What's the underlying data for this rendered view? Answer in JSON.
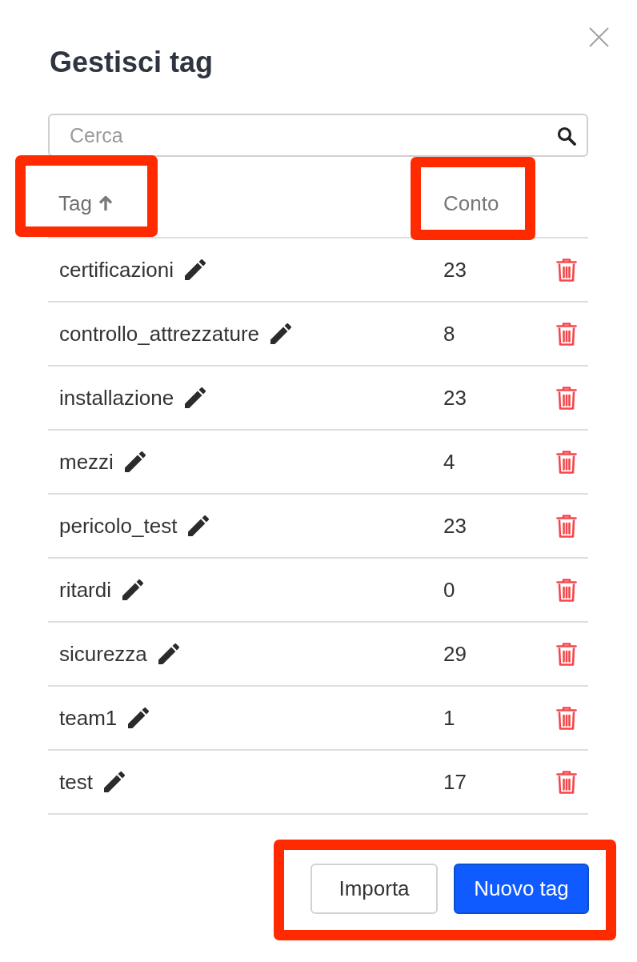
{
  "dialog": {
    "title": "Gestisci tag"
  },
  "search": {
    "placeholder": "Cerca"
  },
  "table": {
    "columns": [
      {
        "label": "Tag",
        "sorted": true,
        "highlighted": true
      },
      {
        "label": "Conto",
        "sorted": false,
        "highlighted": true
      }
    ],
    "rows": [
      {
        "tag": "certificazioni",
        "count": "23"
      },
      {
        "tag": "controllo_attrezzature",
        "count": "8"
      },
      {
        "tag": "installazione",
        "count": "23"
      },
      {
        "tag": "mezzi",
        "count": "4"
      },
      {
        "tag": "pericolo_test",
        "count": "23"
      },
      {
        "tag": "ritardi",
        "count": "0"
      },
      {
        "tag": "sicurezza",
        "count": "29"
      },
      {
        "tag": "team1",
        "count": "1"
      },
      {
        "tag": "test",
        "count": "17"
      }
    ]
  },
  "footer": {
    "highlighted": true,
    "buttons": [
      {
        "label": "Importa",
        "kind": "secondary"
      },
      {
        "label": "Nuovo tag",
        "kind": "primary"
      }
    ]
  }
}
